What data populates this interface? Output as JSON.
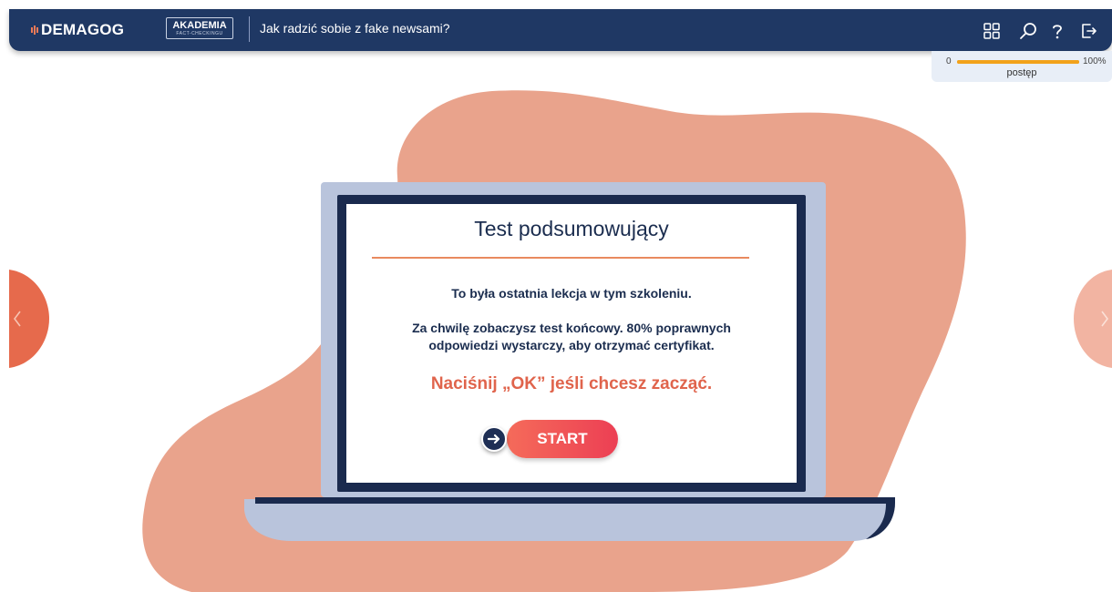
{
  "header": {
    "logo_text": "DEMAGOG",
    "akademia_title": "AKADEMIA",
    "akademia_sub": "FACT-CHECKINGU",
    "course_title": "Jak radzić sobie z fake newsami?",
    "icons": [
      "grid-icon",
      "search-icon",
      "help-icon",
      "exit-icon"
    ]
  },
  "progress": {
    "min_label": "0",
    "max_label": "100%",
    "label": "postęp",
    "value_percent": 100
  },
  "card": {
    "title": "Test podsumowujący",
    "line1": "To była ostatnia lekcja w tym szkoleniu.",
    "line2a": "Za chwilę zobaczysz test końcowy. 80% poprawnych",
    "line2b": "odpowiedzi wystarczy, aby otrzymać certyfikat.",
    "cta": "Naciśnij „OK” jeśli chcesz zacząć.",
    "start_label": "START"
  },
  "nav": {
    "prev_icon": "chevron-left-icon",
    "next_icon": "chevron-right-icon"
  },
  "colors": {
    "header_bg": "#1f3864",
    "blob": "#e9a38c",
    "accent": "#e0644c",
    "progress": "#f2a21b"
  }
}
